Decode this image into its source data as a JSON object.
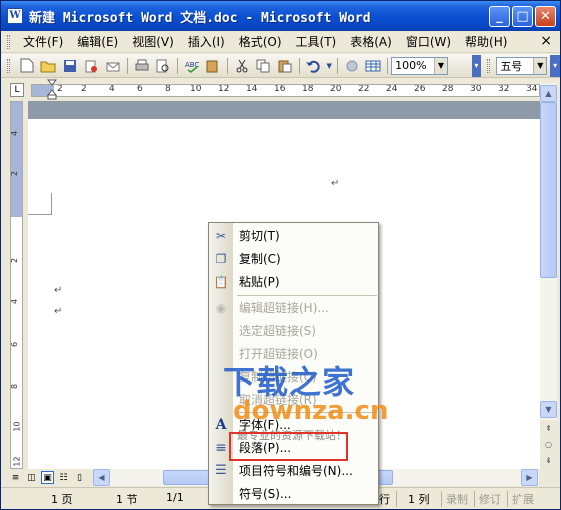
{
  "window": {
    "title": "新建 Microsoft Word 文档.doc - Microsoft Word",
    "app_icon": "W"
  },
  "title_buttons": {
    "minimize": "_",
    "maximize": "□",
    "close": "✕"
  },
  "menubar": {
    "items": [
      "文件(F)",
      "编辑(E)",
      "视图(V)",
      "插入(I)",
      "格式(O)",
      "工具(T)",
      "表格(A)",
      "窗口(W)",
      "帮助(H)"
    ],
    "close": "×"
  },
  "toolbar": {
    "zoom": "100%",
    "font_size": "五号"
  },
  "ruler": {
    "tab_selector": "L",
    "numbers": [
      "2",
      "2",
      "4",
      "6",
      "8",
      "10",
      "12",
      "14",
      "16",
      "18",
      "20",
      "22",
      "24",
      "26",
      "28",
      "30",
      "32",
      "34"
    ],
    "v_numbers": [
      "4",
      "2",
      "2",
      "4",
      "6",
      "8",
      "10",
      "12"
    ]
  },
  "document": {
    "para_mark": "↵"
  },
  "context_menu": {
    "items": [
      {
        "label": "剪切(T)",
        "icon": "scissors-icon",
        "glyph": "✂",
        "enabled": true
      },
      {
        "label": "复制(C)",
        "icon": "copy-icon",
        "glyph": "❐",
        "enabled": true
      },
      {
        "label": "粘贴(P)",
        "icon": "paste-icon",
        "glyph": "📋",
        "enabled": true
      },
      {
        "label": "编辑超链接(H)...",
        "icon": "edit-hyperlink-icon",
        "glyph": "◉",
        "enabled": false
      },
      {
        "label": "选定超链接(S)",
        "icon": "",
        "glyph": "",
        "enabled": false
      },
      {
        "label": "打开超链接(O)",
        "icon": "",
        "glyph": "",
        "enabled": false
      },
      {
        "label": "复制超链接(C)",
        "icon": "",
        "glyph": "",
        "enabled": false
      },
      {
        "label": "取消超链接(R)",
        "icon": "",
        "glyph": "",
        "enabled": false
      },
      {
        "label": "字体(F)...",
        "icon": "font-icon",
        "glyph": "A",
        "enabled": true
      },
      {
        "label": "段落(P)...",
        "icon": "paragraph-icon",
        "glyph": "≡",
        "enabled": true
      },
      {
        "label": "项目符号和编号(N)...",
        "icon": "bullets-icon",
        "glyph": "☰",
        "enabled": true
      },
      {
        "label": "符号(S)...",
        "icon": "",
        "glyph": "",
        "enabled": true
      }
    ]
  },
  "watermark": {
    "line1": "下载之家",
    "line2": "downza.cn",
    "line3": "最专业的资源下载站！"
  },
  "statusbar": {
    "page": "1 页",
    "section": "1 节",
    "page_of": "1/1",
    "line": "行",
    "col": "1 列",
    "rec": "录制",
    "trk": "修订",
    "ext": "扩展"
  }
}
